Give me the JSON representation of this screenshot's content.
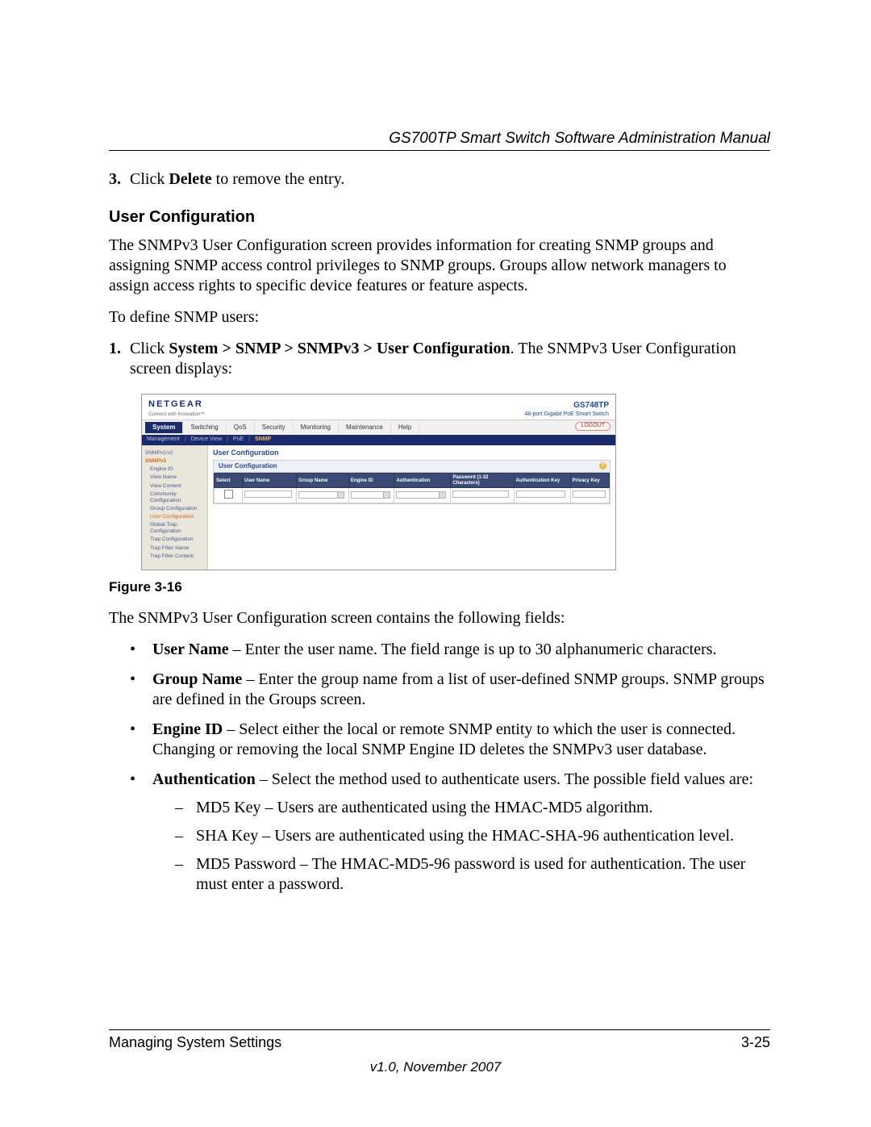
{
  "header": {
    "running_title": "GS700TP Smart Switch Software Administration Manual"
  },
  "steps_top": {
    "num": "3.",
    "prefix": "Click ",
    "bold": "Delete",
    "suffix": " to remove the entry."
  },
  "section_heading": "User Configuration",
  "intro_para": "The SNMPv3 User Configuration screen provides information for creating SNMP groups and assigning SNMP access control privileges to SNMP groups. Groups allow network managers to assign access rights to specific device features or feature aspects.",
  "define_para": "To define SNMP users:",
  "step1": {
    "num": "1.",
    "prefix": "Click ",
    "path": "System > SNMP > SNMPv3 > User Configuration",
    "suffix": ". The SNMPv3 User Configuration screen displays:"
  },
  "screenshot": {
    "brand": "NETGEAR",
    "brand_sub": "Connect with Innovation™",
    "model": "GS748TP",
    "model_sub": "48-port Gigabit PoE Smart Switch",
    "tabs": [
      "System",
      "Switching",
      "QoS",
      "Security",
      "Monitoring",
      "Maintenance",
      "Help"
    ],
    "logout": "LOGOUT",
    "subtabs": [
      "Management",
      "Device View",
      "PoE",
      "SNMP"
    ],
    "sidebar": {
      "sec1": "SNMPv1/v2",
      "sec2": "SNMPv3",
      "items": [
        "Engine ID",
        "View Name",
        "View Content",
        "Community Configuration",
        "Group Configuration",
        "User Configuration",
        "Global Trap Configuration",
        "Trap Configuration",
        "Trap Filter Name",
        "Trap Filter Content"
      ]
    },
    "panel_title": "User Configuration",
    "inner_title": "User Configuration",
    "columns": [
      "Select",
      "User Name",
      "Group Name",
      "Engine ID",
      "Authentication",
      "Password (1-32 Characters)",
      "Authentication Key",
      "Privacy Key"
    ]
  },
  "figure_caption": "Figure 3-16",
  "post_figure": "The SNMPv3 User Configuration screen contains the following fields:",
  "bullets": {
    "user_name": {
      "label": "User Name",
      "text": " – Enter the user name. The field range is up to 30 alphanumeric characters."
    },
    "group_name": {
      "label": "Group Name",
      "text": " – Enter the group name from a list of user-defined SNMP groups. SNMP groups are defined in the Groups screen."
    },
    "engine_id": {
      "label": "Engine ID",
      "text": " – Select either the local or remote SNMP entity to which the user is connected. Changing or removing the local SNMP Engine ID deletes the SNMPv3 user database."
    },
    "authentication": {
      "label": "Authentication",
      "text": " – Select the method used to authenticate users. The possible field values are:"
    }
  },
  "dashes": {
    "md5key": "MD5 Key – Users are authenticated using the HMAC-MD5 algorithm.",
    "shakey": "SHA Key – Users are authenticated using the HMAC-SHA-96 authentication level.",
    "md5pw": "MD5 Password – The HMAC-MD5-96 password is used for authentication. The user must enter a password."
  },
  "footer": {
    "left": "Managing System Settings",
    "right": "3-25",
    "version": "v1.0, November 2007"
  }
}
